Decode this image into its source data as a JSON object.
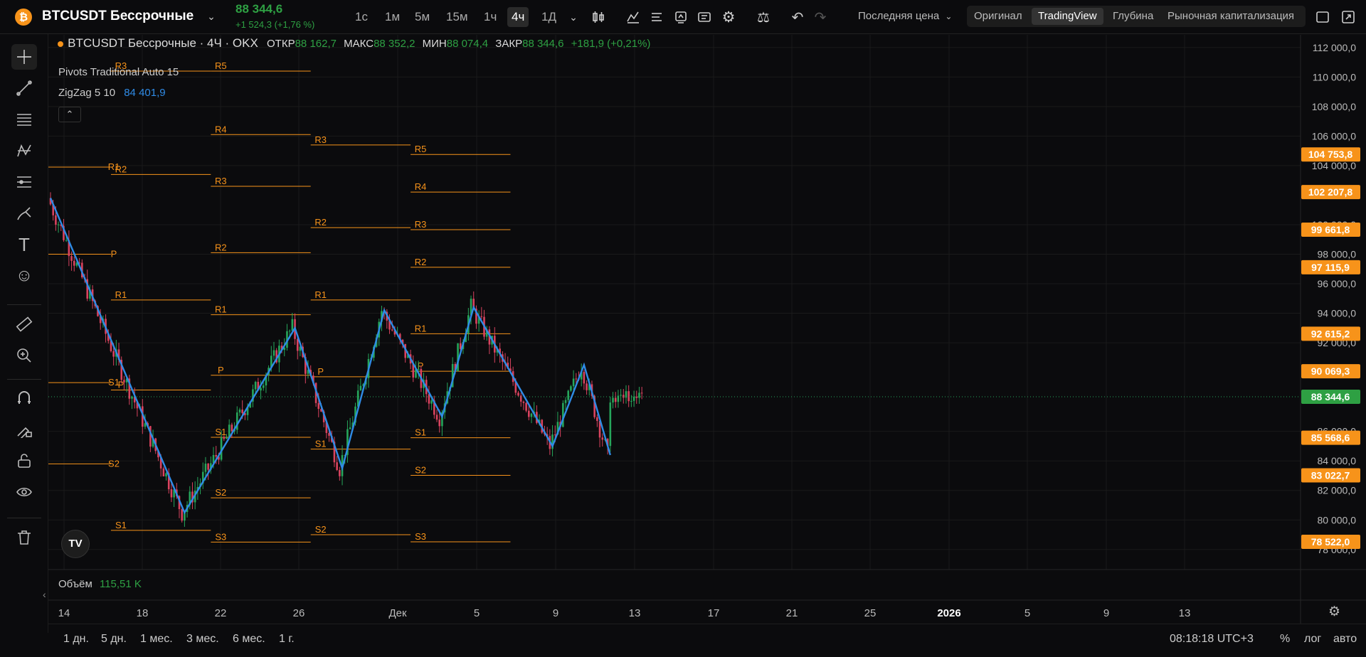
{
  "header": {
    "symbol": "BTCUSDT Бессрочные",
    "price": "88 344,6",
    "change": "+1 524,3 (+1,76 %)",
    "intervals": [
      "1с",
      "1м",
      "5м",
      "15м",
      "1ч",
      "4ч",
      "1Д"
    ],
    "active_interval": "4ч",
    "price_type": "Последняя цена",
    "views": [
      "Оригинал",
      "TradingView",
      "Глубина",
      "Рыночная капитализация"
    ],
    "active_view": "TradingView"
  },
  "legend": {
    "title": "BTCUSDT Бессрочные · 4Ч · OKX",
    "o_label": "ОТКР",
    "o": "88 162,7",
    "h_label": "МАКС",
    "h": "88 352,2",
    "l_label": "МИН",
    "l": "88 074,4",
    "c_label": "ЗАКР",
    "c": "88 344,6",
    "chg": "+181,9 (+0,21%)",
    "ind1": "Pivots Traditional Auto 15",
    "ind2": "ZigZag 5 10",
    "ind2_val": "84 401,9"
  },
  "volume": {
    "label": "Объём",
    "value": "115,51 K"
  },
  "xaxis": [
    "14",
    "18",
    "22",
    "26",
    "Дек",
    "5",
    "9",
    "13",
    "17",
    "21",
    "25",
    "2026",
    "5",
    "9",
    "13"
  ],
  "ranges": [
    "1 дн.",
    "5 дн.",
    "1 мес.",
    "3 мес.",
    "6 мес.",
    "1 г."
  ],
  "time": "08:18:18 UTC+3",
  "scale_opts": [
    "%",
    "лог",
    "авто"
  ],
  "price_labels": [
    {
      "text": "104 753,8",
      "price": 104753.8,
      "color": "#f7931a"
    },
    {
      "text": "102 207,8",
      "price": 102207.8,
      "color": "#f7931a"
    },
    {
      "text": "99 661,8",
      "price": 99661.8,
      "color": "#f7931a"
    },
    {
      "text": "97 115,9",
      "price": 97115.9,
      "color": "#f7931a"
    },
    {
      "text": "92 615,2",
      "price": 92615.2,
      "color": "#f7931a"
    },
    {
      "text": "90 069,3",
      "price": 90069.3,
      "color": "#f7931a"
    },
    {
      "text": "88 344,6",
      "price": 88344.6,
      "color": "#2ea043"
    },
    {
      "text": "85 568,6",
      "price": 85568.6,
      "color": "#f7931a"
    },
    {
      "text": "83 022,7",
      "price": 83022.7,
      "color": "#f7931a"
    },
    {
      "text": "78 522,0",
      "price": 78522.0,
      "color": "#f7931a"
    }
  ],
  "colors": {
    "up": "#26a65b",
    "down": "#d9435f",
    "pivot": "#f7931a",
    "zigzag": "#2f8be6",
    "bg": "#0b0b0d"
  },
  "chart_data": {
    "type": "candlestick",
    "title": "BTCUSDT Бессрочные · 4Ч · OKX",
    "yticks": [
      112000,
      110000,
      108000,
      106000,
      104000,
      100000,
      98000,
      96000,
      94000,
      92000,
      86000,
      84000,
      82000,
      80000,
      78000
    ],
    "ytick_labels": [
      "112 000,0",
      "110 000,0",
      "108 000,0",
      "106 000,0",
      "104 000,0",
      "100 000,0",
      "98 000,0",
      "96 000,0",
      "94 000,0",
      "92 000,0",
      "86 000,0",
      "84 000,0",
      "82 000,0",
      "80 000,0",
      "78 000,0"
    ],
    "ylim": [
      77000,
      112500
    ],
    "zigzag": [
      [
        0,
        101800
      ],
      [
        51,
        80500
      ],
      [
        93,
        93000
      ],
      [
        111,
        83500
      ],
      [
        127,
        94200
      ],
      [
        149,
        87000
      ],
      [
        161,
        94400
      ],
      [
        191,
        85000
      ],
      [
        203,
        90500
      ],
      [
        213,
        84400
      ]
    ],
    "pivot_periods": [
      {
        "from": -10,
        "to": 23,
        "levels": [
          {
            "name": "R1",
            "price": 103900
          },
          {
            "name": "P",
            "price": 98000
          },
          {
            "name": "S1",
            "price": 89300
          },
          {
            "name": "S2",
            "price": 83800
          }
        ]
      },
      {
        "from": 23,
        "to": 61,
        "levels": [
          {
            "name": "R3",
            "price": 110400
          },
          {
            "name": "R2",
            "price": 103400
          },
          {
            "name": "R1",
            "price": 94900
          },
          {
            "name": "P",
            "price": 88800
          },
          {
            "name": "S1",
            "price": 79300
          }
        ]
      },
      {
        "from": 61,
        "to": 99,
        "levels": [
          {
            "name": "R5",
            "price": 110400
          },
          {
            "name": "R4",
            "price": 106100
          },
          {
            "name": "R3",
            "price": 102600
          },
          {
            "name": "R2",
            "price": 98100
          },
          {
            "name": "R1",
            "price": 93900
          },
          {
            "name": "P",
            "price": 89800
          },
          {
            "name": "S1",
            "price": 85600
          },
          {
            "name": "S2",
            "price": 81500
          },
          {
            "name": "S3",
            "price": 78500
          }
        ]
      },
      {
        "from": 99,
        "to": 137,
        "levels": [
          {
            "name": "R3",
            "price": 105400
          },
          {
            "name": "R2",
            "price": 99800
          },
          {
            "name": "R1",
            "price": 94900
          },
          {
            "name": "P",
            "price": 89700
          },
          {
            "name": "S1",
            "price": 84800
          },
          {
            "name": "S2",
            "price": 79000
          }
        ]
      },
      {
        "from": 137,
        "to": 175,
        "levels": [
          {
            "name": "R5",
            "price": 104753.8
          },
          {
            "name": "R4",
            "price": 102207.8
          },
          {
            "name": "R3",
            "price": 99661.8
          },
          {
            "name": "R2",
            "price": 97115.9
          },
          {
            "name": "R1",
            "price": 92615.2
          },
          {
            "name": "P",
            "price": 90069.3
          },
          {
            "name": "S1",
            "price": 85568.6
          },
          {
            "name": "S2",
            "price": 83022.7
          },
          {
            "name": "S3",
            "price": 78522.0
          }
        ]
      }
    ]
  }
}
